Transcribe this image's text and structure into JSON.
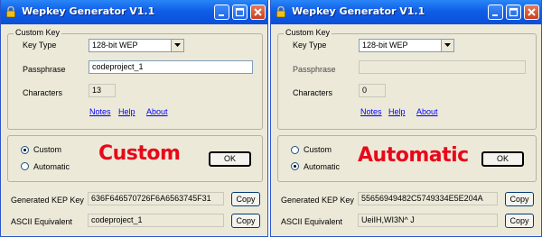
{
  "windows": [
    {
      "id": "left",
      "title": "Wepkey Generator V1.1",
      "group_label": "Custom Key",
      "key_type_label": "Key Type",
      "key_type_value": "128-bit WEP",
      "passphrase_label": "Passphrase",
      "passphrase_value": "codeproject_1",
      "characters_label": "Characters",
      "characters_value": "13",
      "links": {
        "notes": "Notes",
        "help": "Help",
        "about": "About"
      },
      "radio_custom": "Custom",
      "radio_automatic": "Automatic",
      "selected_mode": "Custom",
      "mode_caption": "Custom",
      "ok_label": "OK",
      "generated_label": "Generated KEP Key",
      "generated_value": "636F646570726F6A6563745F31",
      "ascii_label": "ASCII Equivalent",
      "ascii_value": "codeproject_1",
      "copy_label": "Copy"
    },
    {
      "id": "right",
      "title": "Wepkey Generator V1.1",
      "group_label": "Custom Key",
      "key_type_label": "Key Type",
      "key_type_value": "128-bit WEP",
      "passphrase_label": "Passphrase",
      "passphrase_value": "",
      "characters_label": "Characters",
      "characters_value": "0",
      "links": {
        "notes": "Notes",
        "help": "Help",
        "about": "About"
      },
      "radio_custom": "Custom",
      "radio_automatic": "Automatic",
      "selected_mode": "Automatic",
      "mode_caption": "Automatic",
      "ok_label": "OK",
      "generated_label": "Generated KEP Key",
      "generated_value": "55656949482C5749334E5E204A",
      "ascii_label": "ASCII Equivalent",
      "ascii_value": "UeiIH,WI3N^ J",
      "copy_label": "Copy"
    }
  ],
  "colors": {
    "title_bar": "#0f5ee7",
    "caption_red": "#e8081b",
    "link_blue": "#0000ff",
    "window_bg": "#ece9d8"
  },
  "icons": [
    "lock-icon",
    "minimize-icon",
    "maximize-icon",
    "close-icon",
    "chevron-down-icon"
  ]
}
